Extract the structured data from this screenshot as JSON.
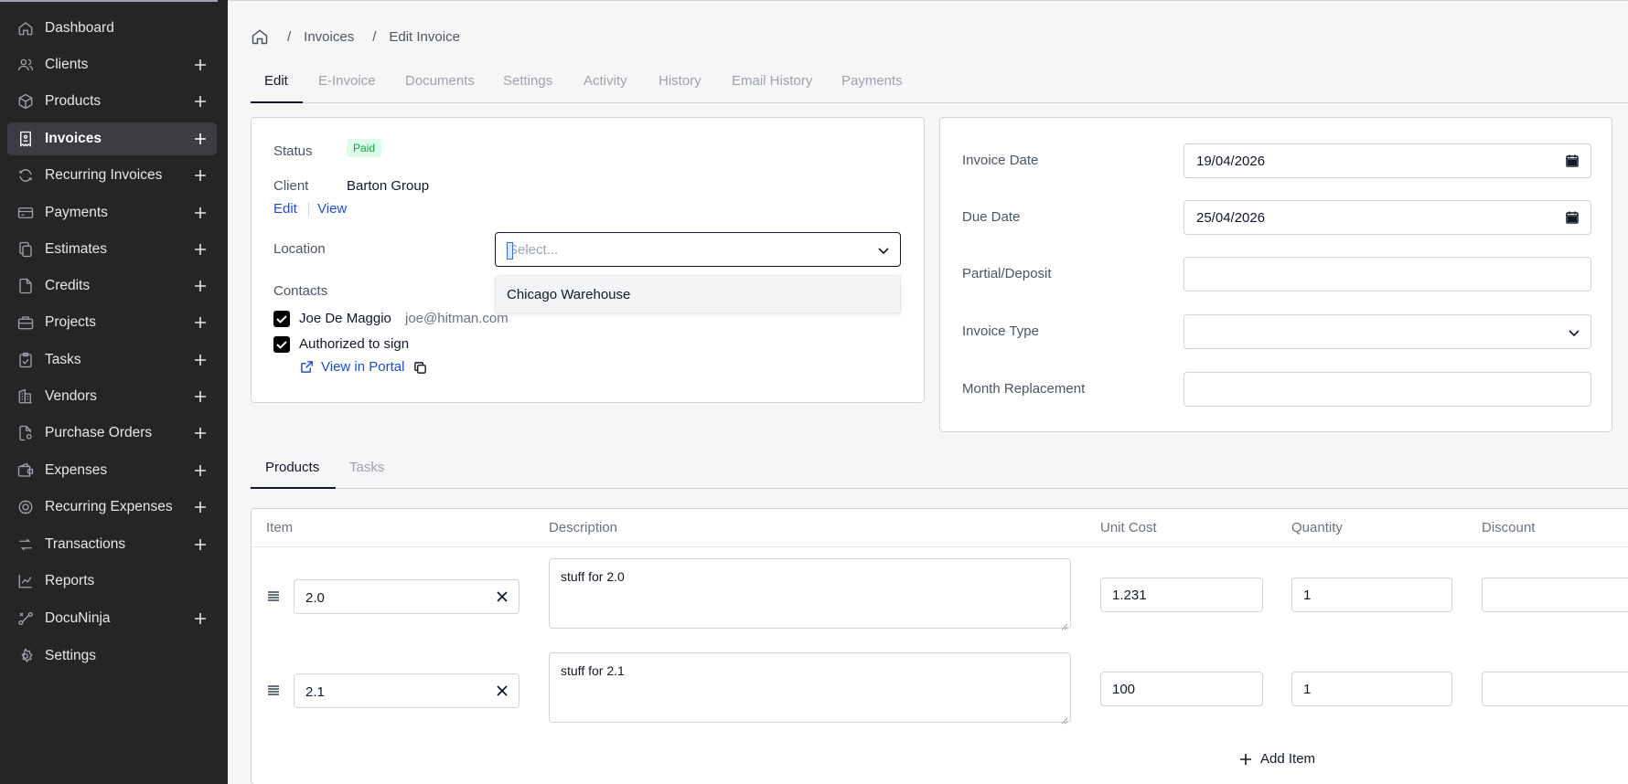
{
  "sidebar": {
    "items": [
      {
        "label": "Dashboard",
        "icon": "home-icon",
        "plus": false,
        "active": false
      },
      {
        "label": "Clients",
        "icon": "users-icon",
        "plus": true,
        "active": false
      },
      {
        "label": "Products",
        "icon": "box-icon",
        "plus": true,
        "active": false
      },
      {
        "label": "Invoices",
        "icon": "receipt-icon",
        "plus": true,
        "active": true
      },
      {
        "label": "Recurring Invoices",
        "icon": "refresh-icon",
        "plus": true,
        "active": false
      },
      {
        "label": "Payments",
        "icon": "credit-card-icon",
        "plus": true,
        "active": false
      },
      {
        "label": "Estimates",
        "icon": "copy-document-icon",
        "plus": true,
        "active": false
      },
      {
        "label": "Credits",
        "icon": "file-icon",
        "plus": true,
        "active": false
      },
      {
        "label": "Projects",
        "icon": "briefcase-icon",
        "plus": true,
        "active": false
      },
      {
        "label": "Tasks",
        "icon": "clipboard-check-icon",
        "plus": true,
        "active": false
      },
      {
        "label": "Vendors",
        "icon": "building-icon",
        "plus": true,
        "active": false
      },
      {
        "label": "Purchase Orders",
        "icon": "file-settings-icon",
        "plus": true,
        "active": false
      },
      {
        "label": "Expenses",
        "icon": "wallet-icon",
        "plus": true,
        "active": false
      },
      {
        "label": "Recurring Expenses",
        "icon": "coins-refresh-icon",
        "plus": true,
        "active": false
      },
      {
        "label": "Transactions",
        "icon": "transfer-icon",
        "plus": true,
        "active": false
      },
      {
        "label": "Reports",
        "icon": "chart-line-icon",
        "plus": false,
        "active": false
      },
      {
        "label": "DocuNinja",
        "icon": "route-icon",
        "plus": true,
        "active": false
      },
      {
        "label": "Settings",
        "icon": "gear-icon",
        "plus": false,
        "active": false
      }
    ]
  },
  "breadcrumb": {
    "home_icon": "home-icon",
    "sep": "/",
    "invoices": "Invoices",
    "current": "Edit Invoice"
  },
  "tabs": [
    "Edit",
    "E-Invoice",
    "Documents",
    "Settings",
    "Activity",
    "History",
    "Email History",
    "Payments"
  ],
  "left_card": {
    "status_label": "Status",
    "status_value": "Paid",
    "client_label": "Client",
    "client_name": "Barton Group",
    "edit_link": "Edit",
    "view_link": "View",
    "location_label": "Location",
    "location_placeholder": "Select...",
    "location_options": [
      "Chicago Warehouse"
    ],
    "contacts_label": "Contacts",
    "contact_name": "Joe De Maggio",
    "contact_email": "joe@hitman.com",
    "authorized_label": "Authorized to sign",
    "portal_link": "View in Portal"
  },
  "right_card": {
    "invoice_date_label": "Invoice Date",
    "invoice_date": "19/04/2026",
    "due_date_label": "Due Date",
    "due_date": "25/04/2026",
    "partial_label": "Partial/Deposit",
    "partial_value": "",
    "invoice_type_label": "Invoice Type",
    "invoice_type_value": "",
    "month_replacement_label": "Month Replacement",
    "month_replacement_value": ""
  },
  "sub_tabs": [
    "Products",
    "Tasks"
  ],
  "products_table": {
    "columns": [
      "Item",
      "Description",
      "Unit Cost",
      "Quantity",
      "Discount"
    ],
    "rows": [
      {
        "item": "2.0",
        "description": "stuff for 2.0",
        "unit_cost": "1.231",
        "quantity": "1",
        "discount": ""
      },
      {
        "item": "2.1",
        "description": "stuff for 2.1",
        "unit_cost": "100",
        "quantity": "1",
        "discount": ""
      }
    ],
    "add_item_label": "Add Item"
  },
  "colors": {
    "sidebar_bg": "#252525",
    "active_item_bg": "#3b3d42",
    "link_blue": "#1d4ed8",
    "paid_badge_bg": "#dcfce7",
    "paid_badge_text": "#16a34a"
  }
}
